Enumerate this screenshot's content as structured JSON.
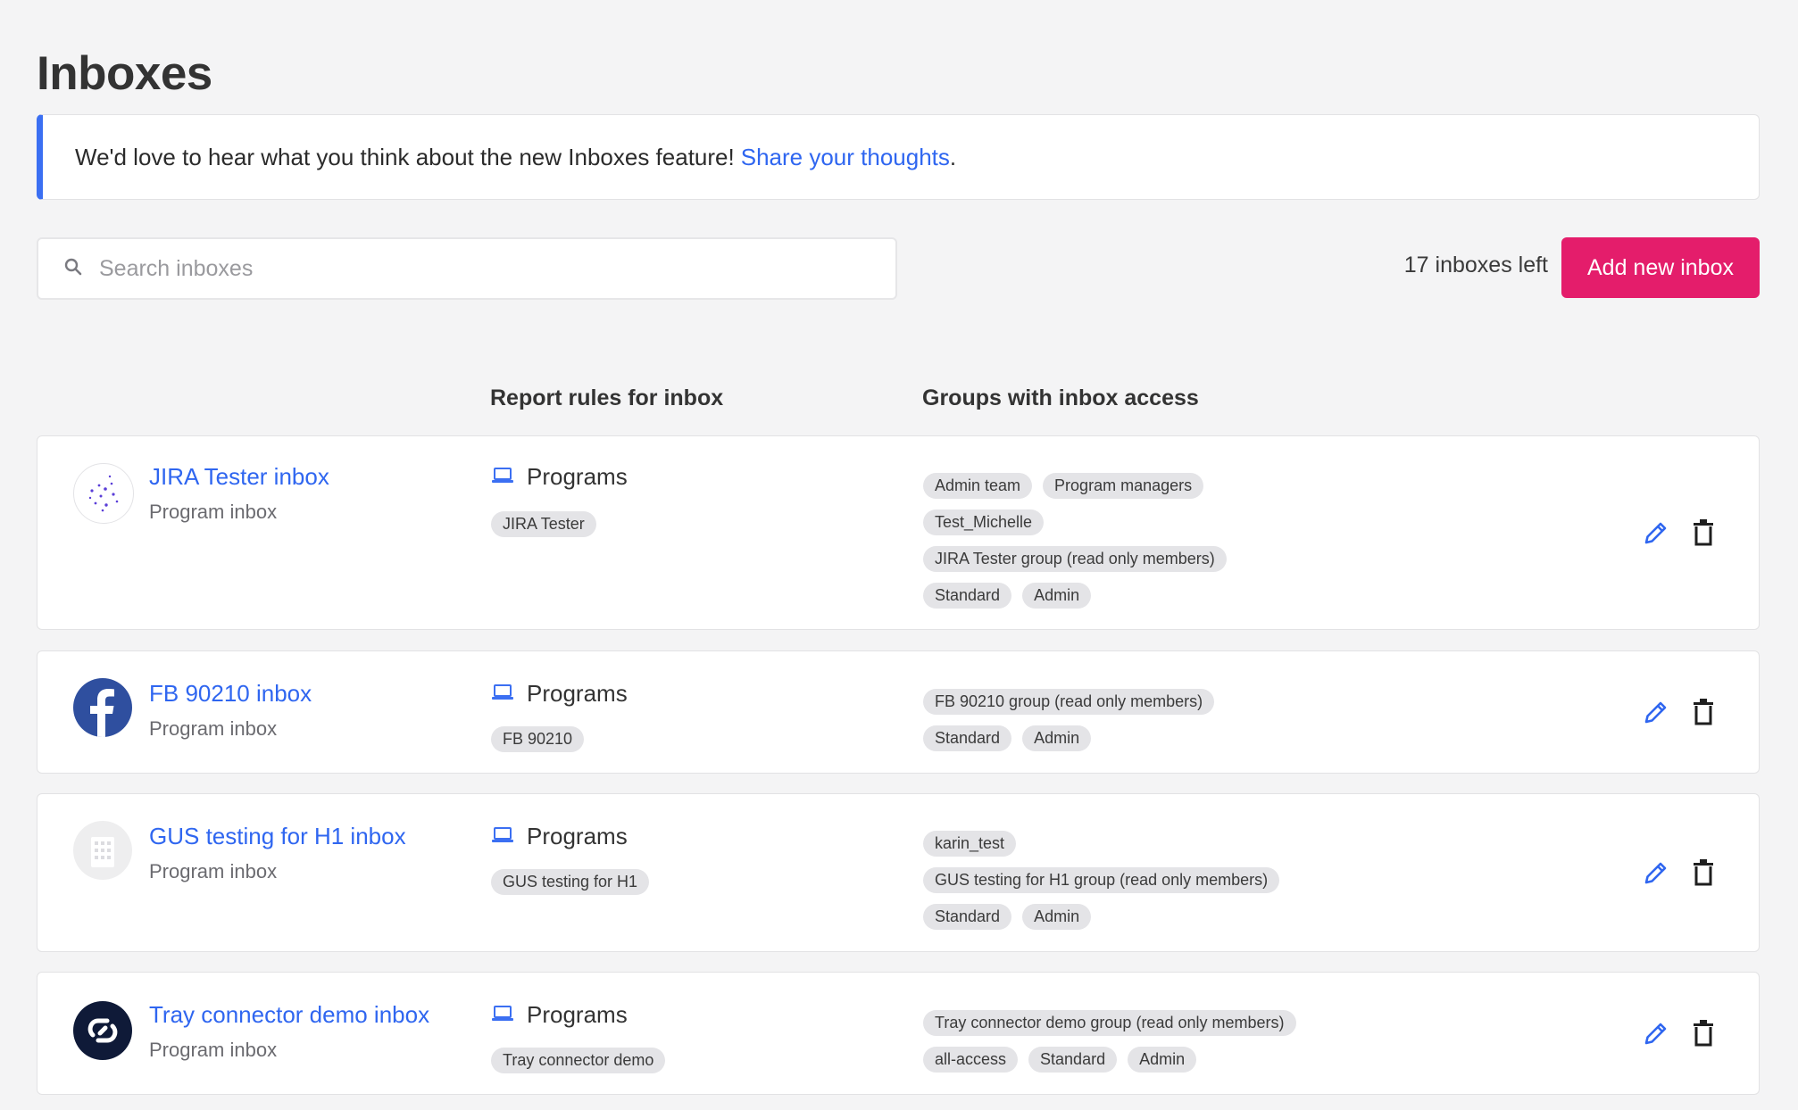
{
  "page": {
    "title": "Inboxes"
  },
  "banner": {
    "text": "We'd love to hear what you think about the new Inboxes feature!",
    "link_text": "Share your thoughts",
    "suffix": "."
  },
  "search": {
    "placeholder": "Search inboxes",
    "value": ""
  },
  "inbox_count": "17 inboxes left",
  "add_button": "Add new inbox",
  "columns": {
    "report_rules": "Report rules for inbox",
    "groups": "Groups with inbox access"
  },
  "colors": {
    "accent_blue": "#2f66f0",
    "primary_pink": "#e41d6b",
    "banner_bar": "#3b6ff2"
  },
  "inboxes": [
    {
      "name": "JIRA Tester inbox",
      "type": "Program inbox",
      "rule_label": "Programs",
      "program": "JIRA Tester",
      "groups": [
        [
          "Admin team",
          "Program managers"
        ],
        [
          "Test_Michelle"
        ],
        [
          "JIRA Tester group (read only members)"
        ],
        [
          "Standard",
          "Admin"
        ]
      ]
    },
    {
      "name": "FB 90210 inbox",
      "type": "Program inbox",
      "rule_label": "Programs",
      "program": "FB 90210",
      "groups": [
        [
          "FB 90210 group (read only members)"
        ],
        [
          "Standard",
          "Admin"
        ]
      ]
    },
    {
      "name": "GUS testing for H1 inbox",
      "type": "Program inbox",
      "rule_label": "Programs",
      "program": "GUS testing for H1",
      "groups": [
        [
          "karin_test"
        ],
        [
          "GUS testing for H1 group (read only members)"
        ],
        [
          "Standard",
          "Admin"
        ]
      ]
    },
    {
      "name": "Tray connector demo inbox",
      "type": "Program inbox",
      "rule_label": "Programs",
      "program": "Tray connector demo",
      "groups": [
        [
          "Tray connector demo group (read only members)"
        ],
        [
          "all-access",
          "Standard",
          "Admin"
        ]
      ]
    }
  ]
}
